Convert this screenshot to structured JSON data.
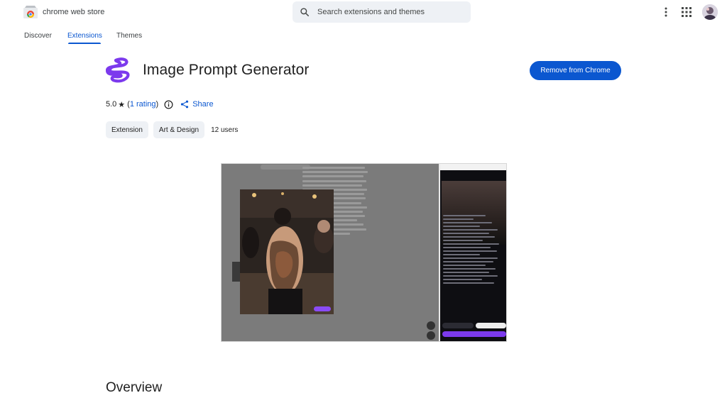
{
  "header": {
    "brand": "chrome web store",
    "search_placeholder": "Search extensions and themes"
  },
  "tabs": [
    {
      "label": "Discover",
      "active": false
    },
    {
      "label": "Extensions",
      "active": true
    },
    {
      "label": "Themes",
      "active": false
    }
  ],
  "item": {
    "title": "Image Prompt Generator",
    "action_label": "Remove from Chrome",
    "rating_value": "5.0",
    "rating_star": "★",
    "rating_open_paren": "(",
    "rating_link": "1 rating",
    "rating_close_paren": ")",
    "share_label": "Share",
    "chips": [
      "Extension",
      "Art & Design"
    ],
    "users": "12 users"
  },
  "section": {
    "overview_title": "Overview"
  },
  "colors": {
    "accent": "#0b57d0",
    "logo_purple": "#7c3aed"
  },
  "icons": [
    "search-icon",
    "more-vert-icon",
    "apps-grid-icon",
    "info-icon",
    "share-icon"
  ]
}
